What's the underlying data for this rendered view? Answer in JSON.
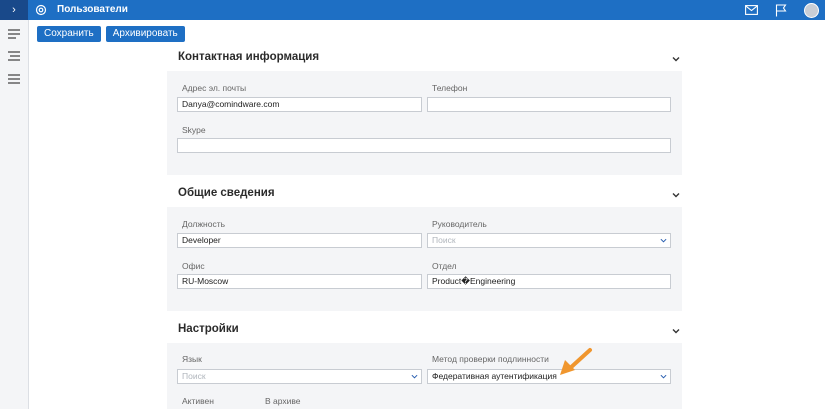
{
  "header": {
    "expander": "›",
    "title": "Пользователи"
  },
  "toolbar": {
    "save_label": "Сохранить",
    "archive_label": "Архивировать"
  },
  "sections": {
    "contact": {
      "title": "Контактная информация",
      "email_label": "Адрес эл. почты",
      "email_value": "Danya@comindware.com",
      "phone_label": "Телефон",
      "phone_value": "",
      "skype_label": "Skype",
      "skype_value": ""
    },
    "general": {
      "title": "Общие сведения",
      "position_label": "Должность",
      "position_value": "Developer",
      "manager_label": "Руководитель",
      "manager_placeholder": "Поиск",
      "office_label": "Офис",
      "office_value": "RU-Moscow",
      "department_label": "Отдел",
      "department_value": "Product�Engineering"
    },
    "settings": {
      "title": "Настройки",
      "language_label": "Язык",
      "language_placeholder": "Поиск",
      "auth_label": "Метод проверки подлинности",
      "auth_value": "Федеративная аутентификация",
      "active_label": "Активен",
      "archive_label": "В архиве"
    }
  },
  "colors": {
    "accent": "#1e6fc4",
    "annotation_arrow": "#f0962e"
  }
}
